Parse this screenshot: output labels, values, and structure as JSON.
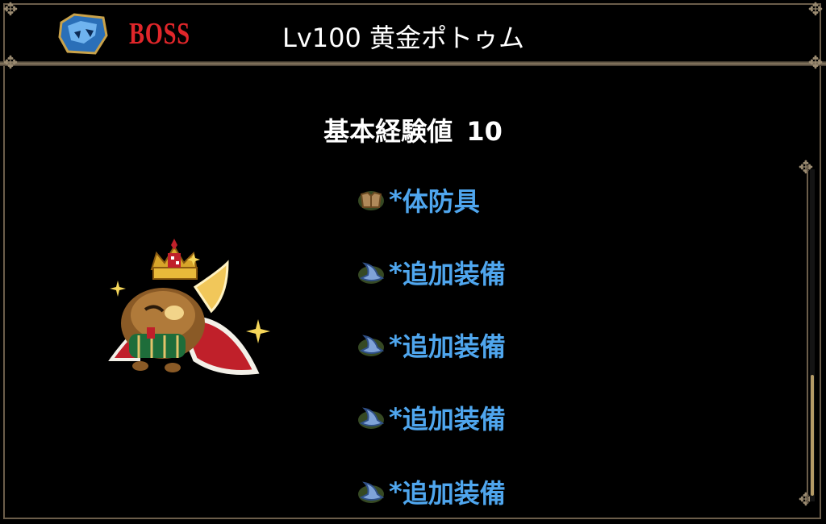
{
  "header": {
    "boss_label": "BOSS",
    "title": "Lv100 黄金ポトゥム"
  },
  "base_exp": {
    "label": "基本経験値",
    "value": "10"
  },
  "drops": [
    {
      "prefix": "*",
      "label": "体防具",
      "icon": "armor-icon"
    },
    {
      "prefix": "*",
      "label": "追加装備",
      "icon": "wizard-hat-icon"
    },
    {
      "prefix": "*",
      "label": "追加装備",
      "icon": "wizard-hat-icon"
    },
    {
      "prefix": "*",
      "label": "追加装備",
      "icon": "wizard-hat-icon"
    },
    {
      "prefix": "*",
      "label": "追加装備",
      "icon": "wizard-hat-icon"
    }
  ],
  "colors": {
    "boss": "#e0262a",
    "drop_text": "#4fa6ee",
    "frame": "#6b5d4a"
  }
}
